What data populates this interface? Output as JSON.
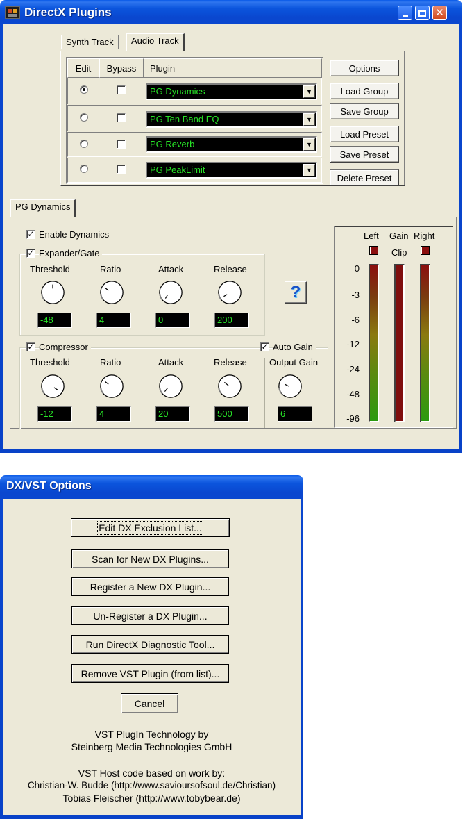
{
  "directx_window": {
    "title": "DirectX Plugins",
    "tabs": [
      "Synth Track",
      "Audio Track"
    ],
    "table_headers": {
      "edit": "Edit",
      "bypass": "Bypass",
      "plugin": "Plugin"
    },
    "plugins": [
      {
        "name": "PG Dynamics",
        "edit_selected": true,
        "bypass": false
      },
      {
        "name": "PG Ten Band EQ",
        "edit_selected": false,
        "bypass": false
      },
      {
        "name": "PG Reverb",
        "edit_selected": false,
        "bypass": false
      },
      {
        "name": "PG PeakLimit",
        "edit_selected": false,
        "bypass": false
      }
    ],
    "buttons": {
      "options": "Options",
      "load_group": "Load Group",
      "save_group": "Save Group",
      "load_preset": "Load Preset",
      "save_preset": "Save Preset",
      "delete_preset": "Delete Preset"
    },
    "dynamics": {
      "tab": "PG Dynamics",
      "enable": {
        "label": "Enable Dynamics",
        "checked": true
      },
      "expander": {
        "label": "Expander/Gate",
        "checked": true,
        "knob_labels": [
          "Threshold",
          "Ratio",
          "Attack",
          "Release"
        ],
        "values": [
          "-48",
          "4",
          "0",
          "200"
        ]
      },
      "compressor": {
        "label": "Compressor",
        "checked": true,
        "knob_labels": [
          "Threshold",
          "Ratio",
          "Attack",
          "Release"
        ],
        "values": [
          "-12",
          "4",
          "20",
          "500"
        ]
      },
      "auto_gain": {
        "label": "Auto Gain",
        "checked": true
      },
      "output_gain": {
        "label": "Output Gain",
        "value": "6"
      },
      "help_glyph": "?",
      "meter": {
        "labels": {
          "left": "Left",
          "gain": "Gain",
          "right": "Right",
          "clip": "Clip"
        },
        "scale": [
          "0",
          "-3",
          "-6",
          "-12",
          "-24",
          "-48",
          "-96"
        ]
      }
    }
  },
  "options_window": {
    "title": "DX/VST Options",
    "buttons": [
      "Edit DX Exclusion List...",
      "Scan for New DX Plugins...",
      "Register a New DX Plugin...",
      "Un-Register a DX Plugin...",
      "Run DirectX Diagnostic Tool...",
      "Remove VST Plugin (from list)..."
    ],
    "cancel": "Cancel",
    "credits": [
      "VST PlugIn Technology by",
      "Steinberg Media Technologies GmbH",
      "VST Host code based on work by:",
      "Christian-W. Budde (http://www.savioursofsoul.de/Christian)",
      "Tobias Fleischer (http://www.tobybear.de)"
    ]
  },
  "icons": [
    "app-icon",
    "minimize-icon",
    "maximize-icon",
    "close-icon",
    "dropdown-arrow-icon",
    "help-icon",
    "checkmark-icon",
    "knob-icon"
  ],
  "colors": {
    "titlebar": "#0a47cf",
    "face": "#ece9d8",
    "lcd_text": "#27e327",
    "lcd_bg": "#000000"
  }
}
